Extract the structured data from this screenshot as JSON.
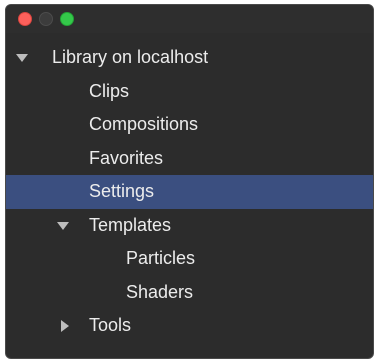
{
  "window": {
    "controls": [
      "close",
      "minimize",
      "zoom"
    ]
  },
  "tree": {
    "root": {
      "label": "Library on localhost",
      "expanded": true,
      "children": [
        {
          "label": "Clips"
        },
        {
          "label": "Compositions"
        },
        {
          "label": "Favorites"
        },
        {
          "label": "Settings",
          "selected": true
        },
        {
          "label": "Templates",
          "expanded": true,
          "children": [
            {
              "label": "Particles"
            },
            {
              "label": "Shaders"
            }
          ]
        },
        {
          "label": "Tools",
          "expanded": false
        }
      ]
    }
  },
  "colors": {
    "background": "#2c2c2c",
    "selection": "#3b4f80",
    "text": "#ececec",
    "close": "#fc605b",
    "zoom": "#34c84a"
  }
}
